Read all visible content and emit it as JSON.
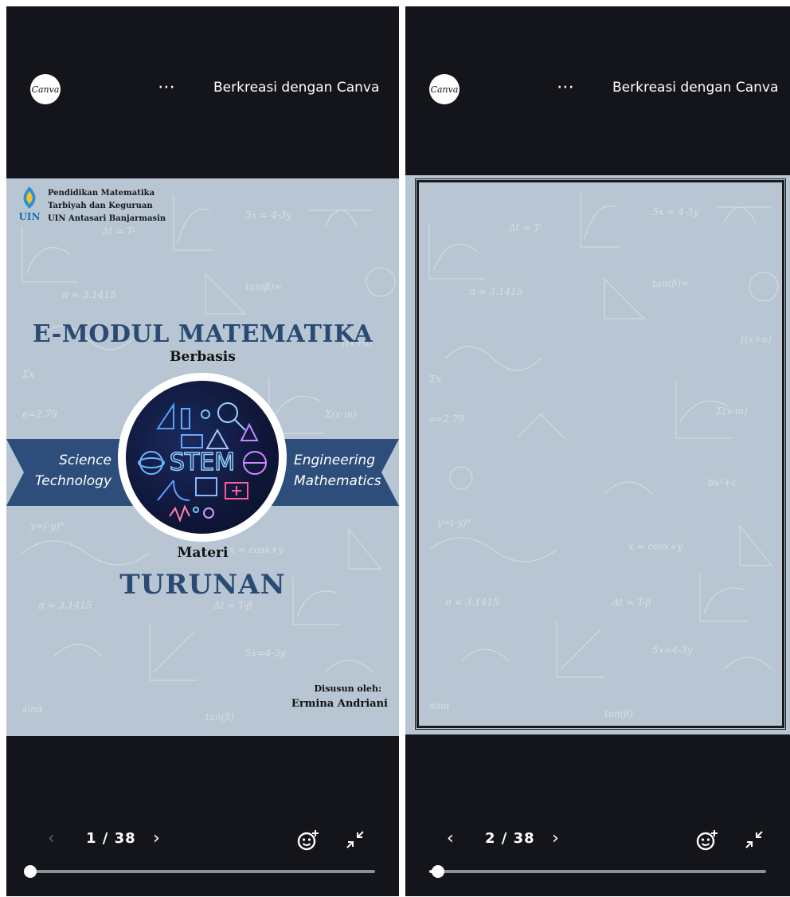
{
  "viewer": {
    "logo_text": "Canva",
    "more_icon": "⋯",
    "brand_text": "Berkreasi dengan Canva"
  },
  "left": {
    "page": {
      "institution": [
        "Pendidikan Matematika",
        "Tarbiyah dan Keguruan",
        "UIN Antasari Banjarmasin"
      ],
      "inst_logo_text": "UIN",
      "title": "E-MODUL MATEMATIKA",
      "subtitle": "Berbasis",
      "ribbon_left": [
        "Science",
        "Technology"
      ],
      "ribbon_right": [
        "Engineering",
        "Mathematics"
      ],
      "stem_text": "STEM",
      "materi_label": "Materi",
      "topic": "TURUNAN",
      "author_label": "Disusun oleh:",
      "author_name": "Ermina Andriani"
    },
    "controls": {
      "prev_icon": "‹",
      "page_indicator": "1 / 38",
      "next_icon": "›",
      "progress_fraction": 0.0
    }
  },
  "right": {
    "controls": {
      "prev_icon": "‹",
      "page_indicator": "2 / 38",
      "next_icon": "›",
      "progress_fraction": 0.026
    }
  },
  "colors": {
    "viewer_bg": "#13151b",
    "page_bg": "#b8c6d3",
    "title_blue": "#2a4a74",
    "ribbon_blue": "#2d4e7b"
  }
}
